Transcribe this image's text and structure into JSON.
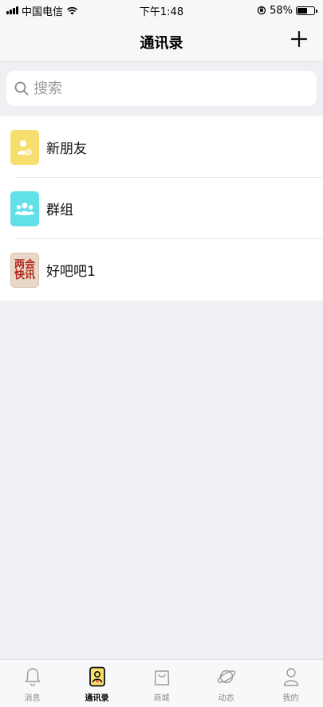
{
  "status_bar": {
    "carrier": "中国电信",
    "time": "下午1:48",
    "battery_percent": "58%",
    "battery_level": 0.58
  },
  "nav": {
    "title": "通讯录",
    "add_icon": "plus-icon"
  },
  "search": {
    "placeholder": "搜索",
    "icon": "search-icon"
  },
  "contacts": [
    {
      "label": "新朋友",
      "icon": "new-friend-icon",
      "color": "#f6df6e"
    },
    {
      "label": "群组",
      "icon": "group-icon",
      "color": "#62e0e8"
    },
    {
      "label": "好吧吧1",
      "avatar_text": [
        "两会",
        "快讯"
      ]
    }
  ],
  "tabs": [
    {
      "label": "消息",
      "icon": "bell-icon",
      "active": false
    },
    {
      "label": "通讯录",
      "icon": "contacts-book-icon",
      "active": true
    },
    {
      "label": "商城",
      "icon": "shopping-bag-icon",
      "active": false
    },
    {
      "label": "动态",
      "icon": "planet-icon",
      "active": false
    },
    {
      "label": "我的",
      "icon": "user-icon",
      "active": false
    }
  ],
  "colors": {
    "accent_yellow": "#f6df6e",
    "accent_cyan": "#62e0e8",
    "background": "#efeff4"
  }
}
